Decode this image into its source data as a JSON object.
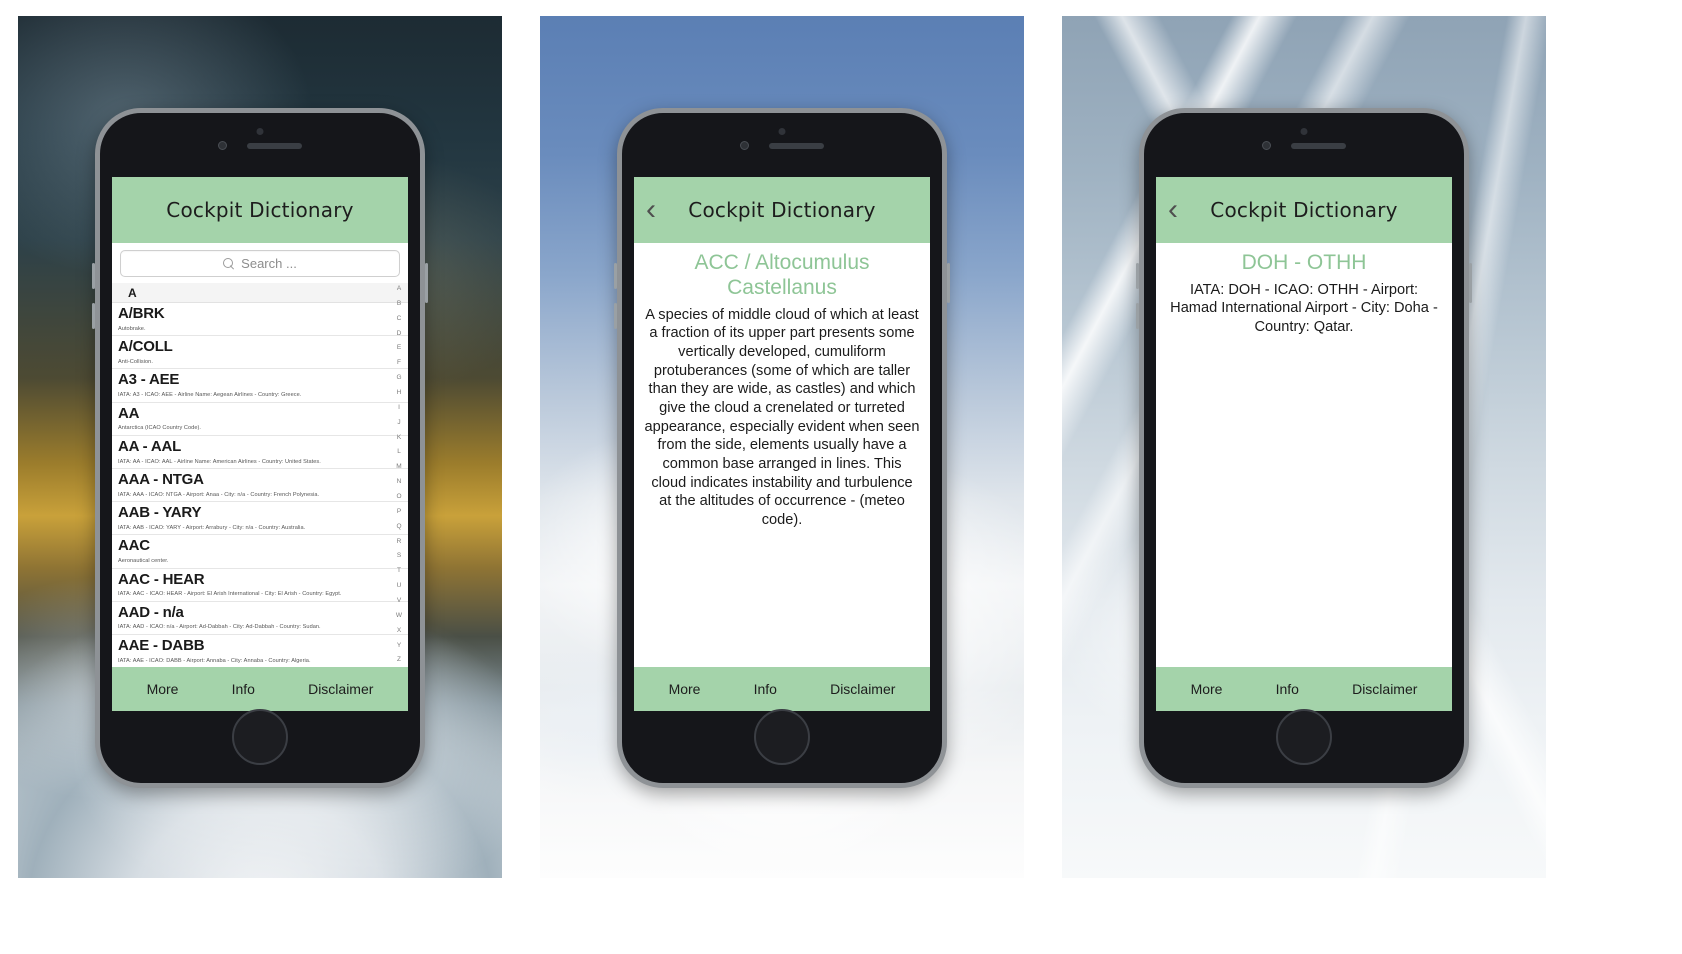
{
  "app": {
    "name": "Cockpit Dictionary",
    "accent_green": "#a4d3aa",
    "title_green": "#8ec596"
  },
  "panels": [
    {
      "id": "list-screen",
      "navbar": {
        "title": "Cockpit Dictionary",
        "has_back": false
      },
      "search": {
        "placeholder": "Search ...",
        "value": "",
        "icon": "search-icon"
      },
      "section_header": "A",
      "rows": [
        {
          "title": "A/BRK",
          "subtitle": "Autobrake."
        },
        {
          "title": "A/COLL",
          "subtitle": "Anti-Collision."
        },
        {
          "title": "A3 - AEE",
          "subtitle": "IATA: A3 - ICAO: AEE - Airline Name: Aegean Airlines - Country: Greece."
        },
        {
          "title": "AA",
          "subtitle": "Antarctica (ICAO Country Code)."
        },
        {
          "title": "AA - AAL",
          "subtitle": "IATA: AA - ICAO: AAL - Airline Name: American Airlines - Country: United States."
        },
        {
          "title": "AAA - NTGA",
          "subtitle": "IATA: AAA - ICAO: NTGA - Airport: Anaa - City: n/a - Country: French Polynesia."
        },
        {
          "title": "AAB - YARY",
          "subtitle": "IATA: AAB - ICAO: YARY - Airport: Arrabury - City: n/a - Country: Australia."
        },
        {
          "title": "AAC",
          "subtitle": "Aeronautical center."
        },
        {
          "title": "AAC - HEAR",
          "subtitle": "IATA: AAC - ICAO: HEAR - Airport: El Arish International - City: El Arish - Country: Egypt."
        },
        {
          "title": "AAD - n/a",
          "subtitle": "IATA: AAD - ICAO: n/a - Airport: Ad-Dabbah - City: Ad-Dabbah - Country: Sudan."
        },
        {
          "title": "AAE - DABB",
          "subtitle": "IATA: AAE - ICAO: DABB - Airport: Annaba - City: Annaba - Country: Algeria."
        }
      ],
      "index_letters": [
        "A",
        "B",
        "C",
        "D",
        "E",
        "F",
        "G",
        "H",
        "I",
        "J",
        "K",
        "L",
        "M",
        "N",
        "O",
        "P",
        "Q",
        "R",
        "S",
        "T",
        "U",
        "V",
        "W",
        "X",
        "Y",
        "Z"
      ],
      "tabbar": [
        "More",
        "Info",
        "Disclaimer"
      ]
    },
    {
      "id": "definition-screen",
      "navbar": {
        "title": "Cockpit Dictionary",
        "has_back": true,
        "back_icon": "chevron-left-icon"
      },
      "detail": {
        "title": "ACC / Altocumulus Castellanus",
        "body": "A species of middle cloud of which at least a fraction of its upper part presents some vertically developed, cumuliform protuberances (some of which are taller than they are wide, as castles) and which give the cloud a crenelated or turreted appearance, especially evident when seen from the side, elements usually have a common base arranged in lines. This cloud indicates instability and turbulence at the altitudes of occurrence - (meteo code)."
      },
      "tabbar": [
        "More",
        "Info",
        "Disclaimer"
      ]
    },
    {
      "id": "airport-screen",
      "navbar": {
        "title": "Cockpit Dictionary",
        "has_back": true,
        "back_icon": "chevron-left-icon"
      },
      "detail": {
        "title": "DOH - OTHH",
        "body": "IATA: DOH - ICAO: OTHH - Airport: Hamad International Airport - City: Doha - Country: Qatar."
      },
      "tabbar": [
        "More",
        "Info",
        "Disclaimer"
      ]
    }
  ]
}
